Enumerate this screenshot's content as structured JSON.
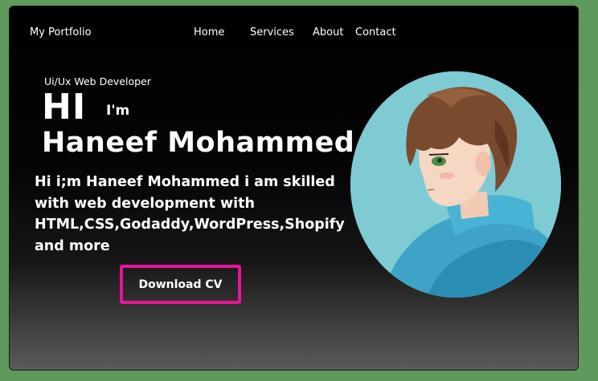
{
  "nav": {
    "brand": "My Portfolio",
    "links": [
      "Home",
      "Services",
      "About",
      "Contact"
    ]
  },
  "hero": {
    "subtitle": "Ui/Ux Web Developer",
    "hi": "HI",
    "im": "I'm",
    "name": "Haneef Mohammed",
    "bio": "Hi i;m Haneef Mohammed i am skilled with web development with HTML,CSS,Godaddy,WordPress,Shopify and more",
    "button_label": "Download CV"
  },
  "colors": {
    "accent": "#e8149a",
    "avatar_bg": "#7ecbd4",
    "page_bg": "#5f9a5c"
  },
  "icons": {
    "avatar": "anime-boy-portrait"
  }
}
